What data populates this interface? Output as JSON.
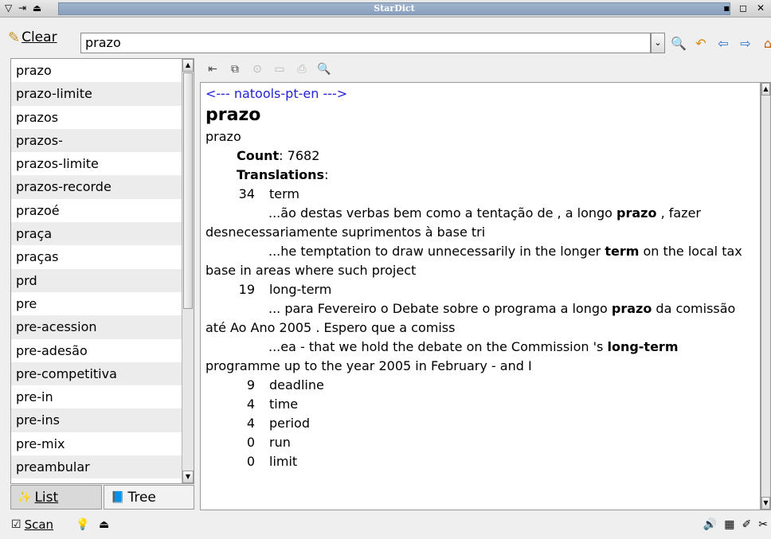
{
  "window": {
    "title": "StarDict",
    "left_controls": "▽ ⇥ ⏏",
    "right_controls": "▪ ◻ ✕"
  },
  "search": {
    "clear_label": "Clear",
    "query": "prazo",
    "combo_arrow": "⌄",
    "toolbar_icons": [
      "find-icon",
      "back-icon",
      "previous-icon",
      "next-icon",
      "home-icon"
    ]
  },
  "word_list": {
    "items": [
      "prazo",
      "prazo-limite",
      "prazos",
      "prazos-",
      "prazos-limite",
      "prazos-recorde",
      "prazoé",
      "praça",
      "praças",
      "prd",
      "pre",
      "pre-acession",
      "pre-adesão",
      "pre-competitiva",
      "pre-in",
      "pre-ins",
      "pre-mix",
      "preambular"
    ]
  },
  "tabs": {
    "list_label": "List",
    "tree_label": "Tree",
    "active": "List"
  },
  "definition": {
    "dictionary": "<--- natools-pt-en --->",
    "headword": "prazo",
    "form": "prazo",
    "count_label": "Count",
    "count_value": ": 7682",
    "translations_label": "Translations",
    "translations_colon": ":",
    "entries": [
      {
        "n": "34",
        "word": "term",
        "pt_before": "...ão destas verbas bem como a tentação de , a longo ",
        "pt_bold": "prazo",
        "pt_after": " , fazer desnecessariamente suprimentos à base tri",
        "en_before": "...he temptation to draw unnecessarily in the longer ",
        "en_bold": "term",
        "en_after": " on the local tax base in areas where such project"
      },
      {
        "n": "19",
        "word": "long-term",
        "pt_before": "... para Fevereiro o Debate sobre o programa a longo ",
        "pt_bold": "prazo",
        "pt_after": " da comissão até Ao Ano 2005 . Espero que a comiss",
        "en_before": "...ea - that we hold the debate on the Commission 's ",
        "en_bold": "long-term",
        "en_after": " programme up to the year 2005 in February - and I"
      }
    ],
    "others": [
      {
        "n": "9",
        "word": "deadline"
      },
      {
        "n": "4",
        "word": "time"
      },
      {
        "n": "4",
        "word": "period"
      },
      {
        "n": "0",
        "word": "run"
      },
      {
        "n": "0",
        "word": "limit"
      }
    ]
  },
  "statusbar": {
    "scan_label": "Scan",
    "scan_checked": "☑"
  }
}
